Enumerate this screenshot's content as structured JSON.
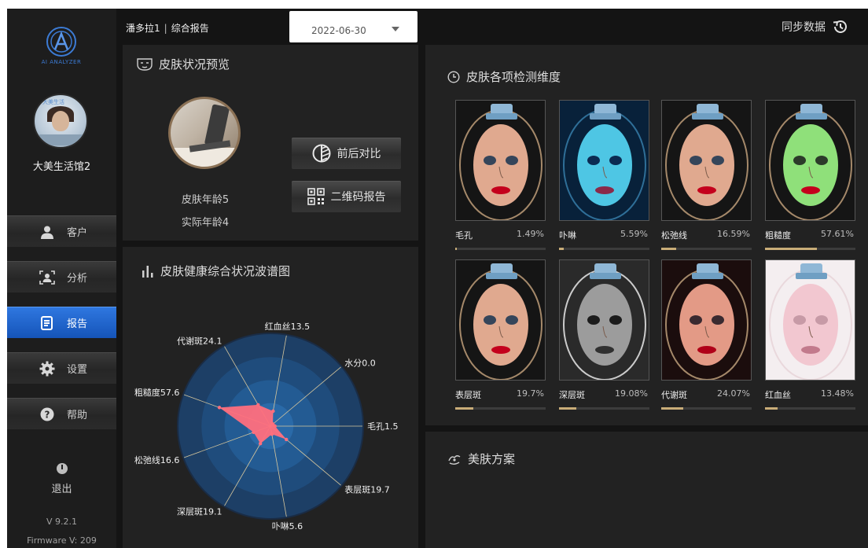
{
  "sidebar": {
    "logo_text": "AI ANALYZER",
    "store_name": "大美生活馆2",
    "avatar_text": "大美生活",
    "nav": [
      {
        "label": "客户",
        "icon": "user-icon"
      },
      {
        "label": "分析",
        "icon": "face-scan-icon"
      },
      {
        "label": "报告",
        "icon": "report-icon",
        "active": true
      },
      {
        "label": "设置",
        "icon": "gear-icon"
      },
      {
        "label": "帮助",
        "icon": "help-icon"
      }
    ],
    "logout_label": "退出",
    "version": "V 9.2.1",
    "firmware": "Firmware V: 209"
  },
  "header": {
    "client_name": "潘多拉1",
    "page_title": "综合报告",
    "date_value": "2022-06-30",
    "sync_label": "同步数据"
  },
  "preview": {
    "title": "皮肤状况预览",
    "skin_age": "皮肤年龄5",
    "real_age": "实际年龄4",
    "compare_label": "前后对比",
    "qr_label": "二维码报告"
  },
  "radar": {
    "title": "皮肤健康综合状况波谱图"
  },
  "chart_data": {
    "type": "radar",
    "title": "皮肤健康综合状况波谱图",
    "axes": [
      "红血丝",
      "水分",
      "毛孔",
      "表层斑",
      "卟啉",
      "深层斑",
      "松弛线",
      "粗糙度",
      "代谢斑"
    ],
    "values": [
      13.5,
      0.0,
      1.5,
      19.7,
      5.6,
      19.1,
      16.6,
      57.6,
      24.1
    ],
    "labels": [
      "红血丝13.5",
      "水分0.0",
      "毛孔1.5",
      "表层斑19.7",
      "卟啉5.6",
      "深层斑19.1",
      "松弛线16.6",
      "粗糙度57.6",
      "代谢斑24.1"
    ],
    "range": [
      0,
      100
    ],
    "rings": 4,
    "fill_color": "#ff6f7d"
  },
  "dimensions": {
    "title": "皮肤各项检测维度",
    "items": [
      {
        "label": "毛孔",
        "value": "1.49%",
        "pct": 1.49,
        "tint": "normal"
      },
      {
        "label": "卟啉",
        "value": "5.59%",
        "pct": 5.59,
        "tint": "blue"
      },
      {
        "label": "松弛线",
        "value": "16.59%",
        "pct": 16.59,
        "tint": "normal"
      },
      {
        "label": "粗糙度",
        "value": "57.61%",
        "pct": 57.61,
        "tint": "green"
      },
      {
        "label": "表层斑",
        "value": "19.7%",
        "pct": 19.7,
        "tint": "normal"
      },
      {
        "label": "深层斑",
        "value": "19.08%",
        "pct": 19.08,
        "tint": "gray"
      },
      {
        "label": "代谢斑",
        "value": "24.07%",
        "pct": 24.07,
        "tint": "warm"
      },
      {
        "label": "红血丝",
        "value": "13.48%",
        "pct": 13.48,
        "tint": "pink"
      }
    ]
  },
  "plan": {
    "title": "美肤方案"
  },
  "colors": {
    "accent_blue": "#1f63cc",
    "bar_fill": "#c9ad78",
    "radar_fill": "#ff6f7d"
  }
}
